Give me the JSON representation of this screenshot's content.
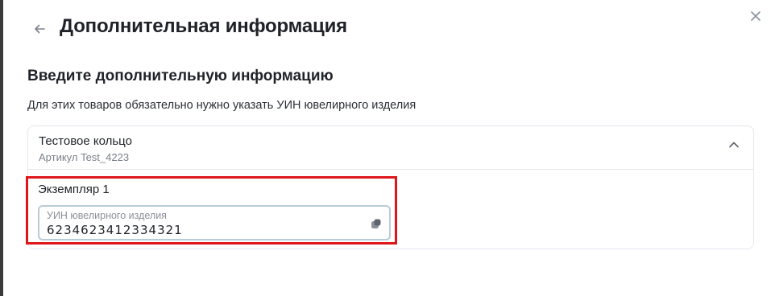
{
  "modal": {
    "title": "Дополнительная информация",
    "back_icon": "arrow-left-icon",
    "close_icon": "close-icon"
  },
  "section": {
    "heading": "Введите дополнительную информацию",
    "hint": "Для этих товаров обязательно нужно указать УИН ювелирного изделия"
  },
  "product": {
    "name": "Тестовое кольцо",
    "sku": "Артикул Test_4223",
    "expanded": true,
    "toggle_icon": "chevron-up-icon",
    "instance": {
      "label": "Экземпляр 1",
      "field_label": "УИН ювелирного изделия",
      "field_value": "6234623412334321",
      "field_icon": "autofill-key-icon"
    }
  },
  "colors": {
    "highlight": "#e0151b",
    "field_border": "#b9cbd8",
    "card_border": "#e4e7ec"
  }
}
